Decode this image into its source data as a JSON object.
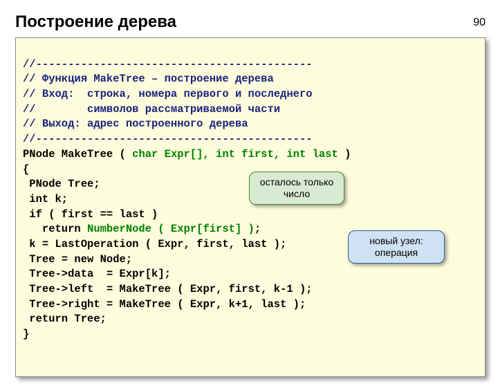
{
  "page_number": "90",
  "title": "Построение дерева",
  "code": {
    "c1": "//-------------------------------------------",
    "c2": "// Функция MakeTree – построение дерева",
    "c3": "// Вход:  строка, номера первого и последнего",
    "c4": "//        символов рассматриваемой части",
    "c5": "// Выход: адрес построенного дерева",
    "c6": "//-------------------------------------------",
    "l1a": "PNode MakeTree ( ",
    "l1b": "char Expr[], int first, int last",
    "l1c": " )",
    "l2": "{",
    "l3": " PNode Tree;",
    "l4": " int k;",
    "l5": " if ( first == last )",
    "l6a": "   return ",
    "l6b": "NumberNode ( Expr[first] )",
    "l6c": ";",
    "l7": " k = LastOperation ( Expr, first, last );",
    "l8": " Tree = new Node;",
    "l9": " Tree->data  = Expr[k];",
    "l10": " Tree->left  = MakeTree ( Expr, first, k-1 );",
    "l11": " Tree->right = MakeTree ( Expr, k+1, last );",
    "l12": " return Tree;",
    "l13": "}"
  },
  "callouts": {
    "only_number": "осталось только число",
    "new_node": "новый узел: операция"
  }
}
